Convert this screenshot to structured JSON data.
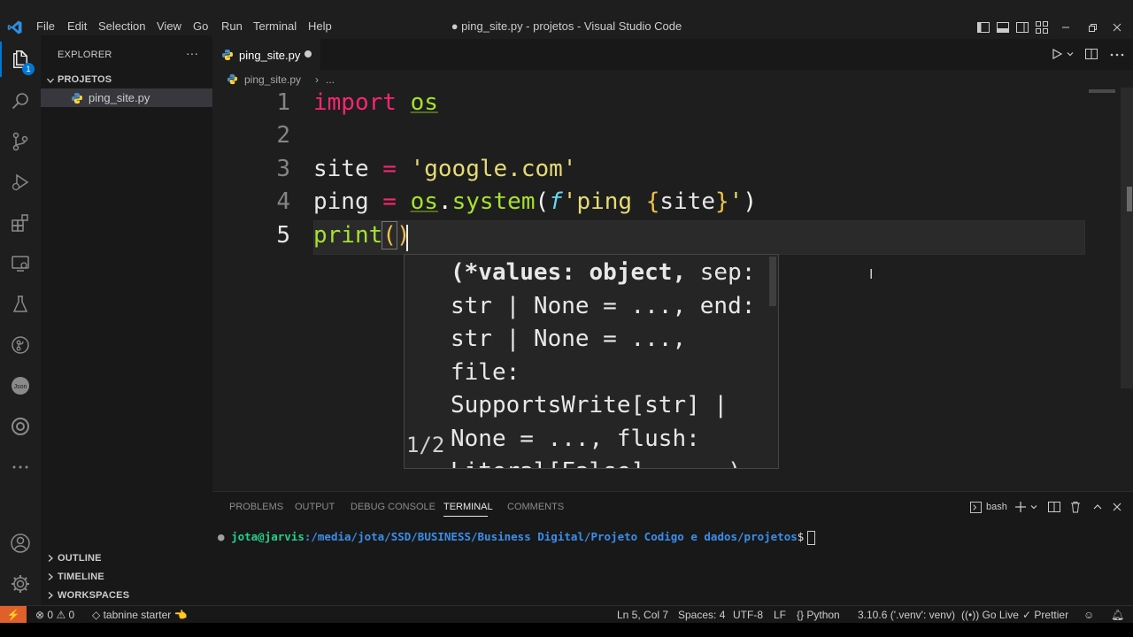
{
  "titlebar": {
    "menu": [
      "File",
      "Edit",
      "Selection",
      "View",
      "Go",
      "Run",
      "Terminal",
      "Help"
    ],
    "title": "● ping_site.py - projetos - Visual Studio Code"
  },
  "activity": {
    "explorer_badge": "1"
  },
  "sidebar": {
    "header": "EXPLORER",
    "more": "···",
    "folder": "PROJETOS",
    "file": "ping_site.py",
    "sections": [
      "OUTLINE",
      "TIMELINE",
      "WORKSPACES"
    ]
  },
  "editor": {
    "tab_label": "ping_site.py",
    "breadcrumb_file": "ping_site.py",
    "breadcrumb_more": "...",
    "line_numbers": [
      "1",
      "2",
      "3",
      "4",
      "5"
    ],
    "lines": {
      "l1_kw": "import",
      "l1_mod": "os",
      "l3_var": "site",
      "l3_eq": "=",
      "l3_str": "'google.com'",
      "l4_var": "ping",
      "l4_eq": "=",
      "l4_mod": "os",
      "l4_dot": ".",
      "l4_fn": "system",
      "l4_open": "(",
      "l4_f": "f",
      "l4_str1": "'ping ",
      "l4_b1": "{",
      "l4_inner": "site",
      "l4_b2": "}",
      "l4_str2": "'",
      "l4_close": ")",
      "l5_fn": "print",
      "l5_open": "(",
      "l5_close": ")"
    },
    "hover": {
      "counter": "1/2",
      "signature_bold": "(*values: object,",
      "signature_rest": "sep: str | None = ..., end: str | None = ..., file: SupportsWrite[str] | None = ..., flush: Literal[False] = ...)"
    }
  },
  "panel": {
    "tabs": [
      "PROBLEMS",
      "OUTPUT",
      "DEBUG CONSOLE",
      "TERMINAL",
      "COMMENTS"
    ],
    "active_tab": "TERMINAL",
    "shell": "bash",
    "prompt_user": "jota@jarvis",
    "prompt_path": ":/media/jota/SSD/BUSINESS/Business Digital/Projeto Codigo e dados/projetos",
    "prompt_symbol": "$"
  },
  "status": {
    "remote": "⚡",
    "errors": "0",
    "warnings": "0",
    "tabnine": "tabnine starter 👈",
    "position": "Ln 5, Col 7",
    "spaces": "Spaces: 4",
    "encoding": "UTF-8",
    "eol": "LF",
    "language": "Python",
    "interpreter": "3.10.6 ('.venv': venv)",
    "golive": "Go Live",
    "prettier": "Prettier"
  },
  "colors": {
    "accent": "#0078d4",
    "keyword": "#f92672",
    "function": "#a6e22e",
    "string": "#e6db74",
    "remote_bg": "#e0602c"
  }
}
